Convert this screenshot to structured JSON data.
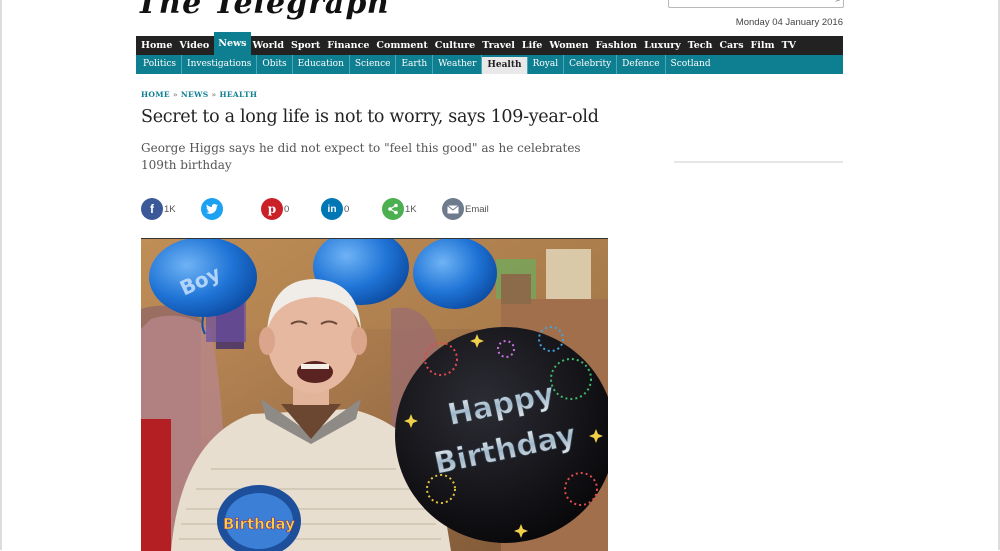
{
  "masthead": {
    "title": "The Telegraph"
  },
  "header": {
    "search_placeholder": "",
    "date": "Monday 04 January 2016"
  },
  "nav": {
    "primary": [
      "Home",
      "Video",
      "News",
      "World",
      "Sport",
      "Finance",
      "Comment",
      "Culture",
      "Travel",
      "Life",
      "Women",
      "Fashion",
      "Luxury",
      "Tech",
      "Cars",
      "Film",
      "TV"
    ],
    "primary_active": "News",
    "secondary": [
      "Politics",
      "Investigations",
      "Obits",
      "Education",
      "Science",
      "Earth",
      "Weather",
      "Health",
      "Royal",
      "Celebrity",
      "Defence",
      "Scotland"
    ],
    "secondary_active": "Health"
  },
  "breadcrumb": [
    "HOME",
    "NEWS",
    "HEALTH"
  ],
  "article": {
    "headline": "Secret to a long life is not to worry, says 109-year-old",
    "standfirst": "George Higgs says he did not expect to \"feel this good\" as he celebrates 109th birthday"
  },
  "share": [
    {
      "network": "facebook",
      "icon": "f",
      "count": "1K",
      "color": "#3b5998"
    },
    {
      "network": "twitter",
      "icon": "t",
      "count": "",
      "color": "#1da1f2"
    },
    {
      "network": "pinterest",
      "icon": "p",
      "count": "0",
      "color": "#cb2027"
    },
    {
      "network": "linkedin",
      "icon": "in",
      "count": "0",
      "color": "#0077b5"
    },
    {
      "network": "share",
      "icon": "share",
      "count": "1K",
      "color": "#4caf50"
    },
    {
      "network": "email",
      "icon": "envelope",
      "count": "Email",
      "color": "#6d7b8d"
    }
  ],
  "image": {
    "balloon_text_1": "Happy",
    "balloon_text_2": "Birthday",
    "badge_text": "Birthday",
    "blue_balloon_text": "Boy"
  },
  "colors": {
    "nav_primary_bg": "#222222",
    "accent": "#0e7f91",
    "breadcrumb": "#0e7f91"
  }
}
